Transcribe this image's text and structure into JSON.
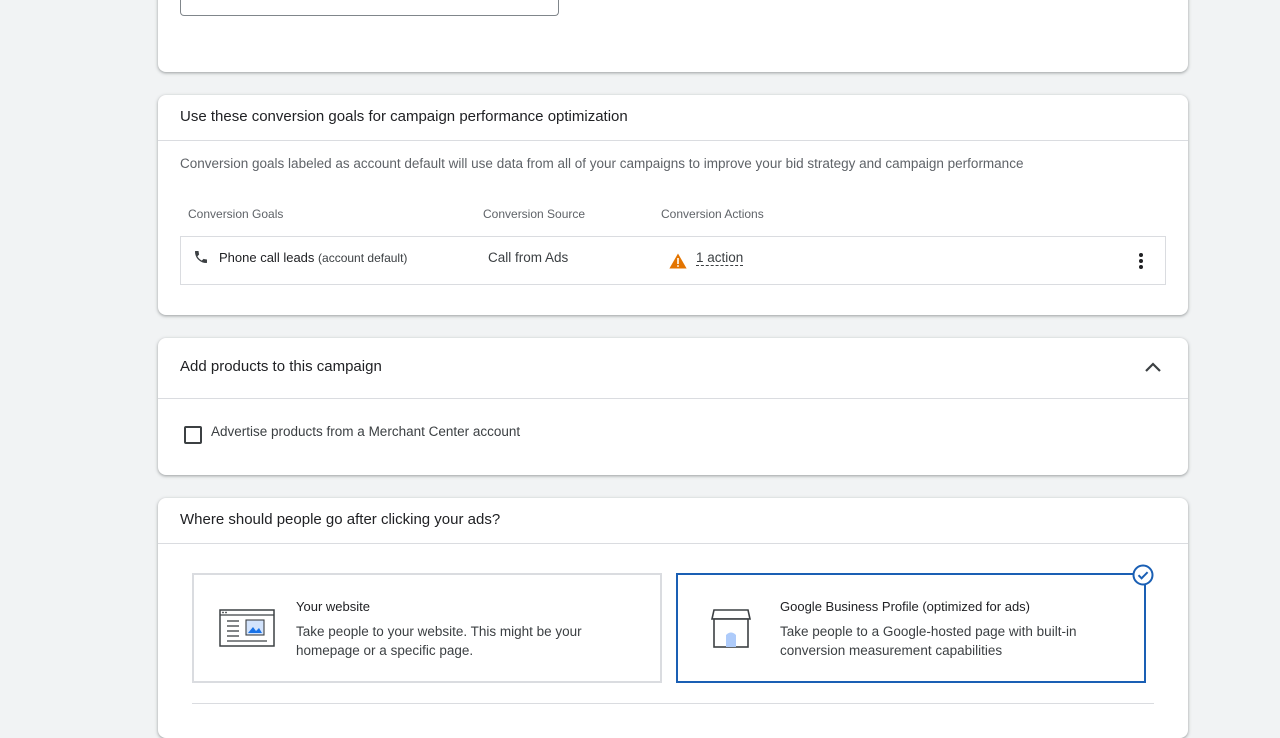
{
  "goals_card": {
    "title": "Use these conversion goals for campaign performance optimization",
    "description": "Conversion goals labeled as account default will use data from all of your campaigns to improve your bid strategy and campaign performance",
    "columns": [
      "Conversion Goals",
      "Conversion Source",
      "Conversion Actions"
    ],
    "rows": [
      {
        "icon": "phone-icon",
        "goal": "Phone call leads",
        "goal_note": "(account default)",
        "source": "Call from Ads",
        "warning_icon": "warning-icon",
        "actions": "1 action",
        "menu_icon": "more-vert-icon"
      }
    ]
  },
  "products_card": {
    "title": "Add products to this campaign",
    "collapse_icon": "chevron-up-icon",
    "checkbox_label": "Advertise products from a Merchant Center account",
    "checkbox_checked": false
  },
  "destination_card": {
    "title": "Where should people go after clicking your ads?",
    "options": [
      {
        "icon": "website-icon",
        "title": "Your website",
        "description": "Take people to your website. This might be your homepage or a specific page.",
        "selected": false
      },
      {
        "icon": "storefront-icon",
        "title": "Google Business Profile (optimized for ads)",
        "description": "Take people to a Google-hosted page with built-in conversion measurement capabilities",
        "selected": true
      }
    ]
  },
  "colors": {
    "accent": "#1a5fb4",
    "warning": "#e37400",
    "divider": "#dadce0",
    "page_background": "#f1f3f4"
  }
}
